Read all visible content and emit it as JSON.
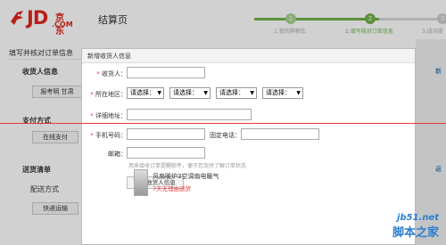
{
  "header": {
    "logo": {
      "text": "JD",
      "cn": "京东",
      "com": ".COM"
    },
    "page_title": "结算页",
    "steps": [
      {
        "num": "1",
        "label": "1.我的购物车"
      },
      {
        "num": "2",
        "label": "2.填写核对订单信息"
      },
      {
        "num": "3",
        "label": "3.成功提"
      }
    ]
  },
  "main": {
    "section_title": "填写并核对订单信息",
    "consignee_title": "收货人信息",
    "consignee_button": "报考明 甘肃",
    "payment_title": "支付方式",
    "payment_button": "在线支付",
    "delivery_title": "送货清单",
    "delivery_method_label": "配送方式",
    "delivery_method_button": "快递运输",
    "right_link_1": "新",
    "right_link_2": "返"
  },
  "modal": {
    "title": "新增收货人信息",
    "fields": {
      "name_label": "收货人：",
      "region_label": "所在地区：",
      "address_label": "详细地址：",
      "phone_label": "手机号码：",
      "tel_label": "固定电话：",
      "email_label": "邮箱："
    },
    "selects": [
      "请选择：",
      "请选择：",
      "请选择：",
      "请选择："
    ],
    "email_hint": "用来接收订单提醒邮件，便于您及时了解订单状态",
    "save_button": "保存收货人信息"
  },
  "product": {
    "caption": "风扇暖炉3空调扇电暖气",
    "promo": "7天无理由退货"
  },
  "watermark": {
    "line1": "jb51.net",
    "line2": "脚本之家"
  },
  "colors": {
    "brand_red": "#e1251b",
    "step_green": "#6fb347",
    "step_gray": "#d8d8d8"
  }
}
